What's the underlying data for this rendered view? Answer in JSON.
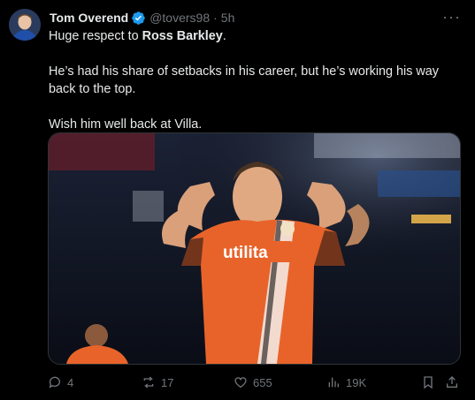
{
  "tweet": {
    "author_name": "Tom Overend",
    "handle": "@tovers98",
    "separator": "·",
    "time": "5h",
    "more_label": "···",
    "lines": {
      "l1_prefix": "Huge respect to ",
      "l1_bold": "Ross Barkley",
      "l1_suffix": ".",
      "l2": "He’s had his share of setbacks in his career, but he’s working his way back to the top.",
      "l3": "Wish him well back at Villa."
    },
    "image": {
      "sponsor_text": "utilita",
      "shirt_color": "#e8632a"
    },
    "actions": {
      "replies": "4",
      "reposts": "17",
      "likes": "655",
      "views": "19K"
    }
  },
  "colors": {
    "background": "#000000",
    "text": "#e7e9ea",
    "muted": "#71767b",
    "verified": "#1d9bf0"
  }
}
